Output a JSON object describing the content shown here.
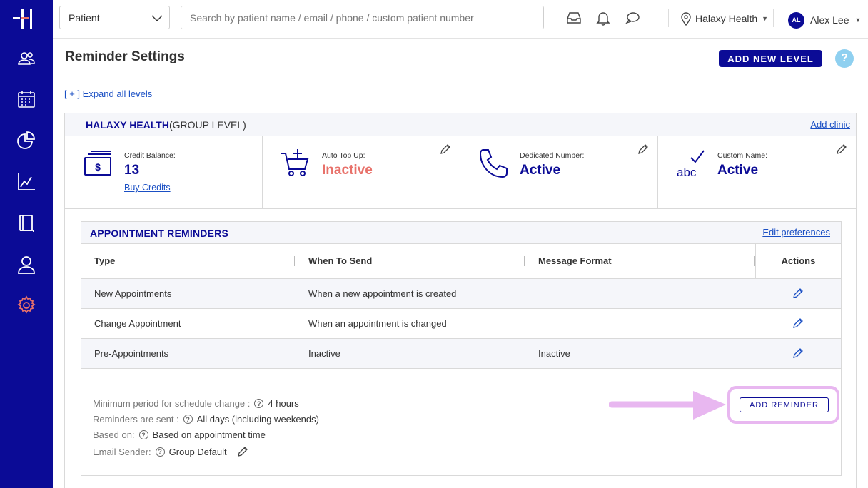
{
  "colors": {
    "brand": "#0b0b96",
    "link": "#1a4fc4",
    "inactive": "#e8716a",
    "highlight": "#e8b7f0",
    "settings_active": "#e8716a"
  },
  "sidebar": {
    "items": [
      {
        "icon": "users-icon"
      },
      {
        "icon": "calendar-icon"
      },
      {
        "icon": "pie-chart-icon"
      },
      {
        "icon": "line-chart-icon"
      },
      {
        "icon": "book-icon"
      },
      {
        "icon": "user-icon"
      },
      {
        "icon": "settings-icon"
      }
    ]
  },
  "topbar": {
    "filter_value": "Patient",
    "search_placeholder": "Search by patient name / email / phone / custom patient number",
    "location": "Halaxy Health",
    "user_initials": "AL",
    "user_name": "Alex Lee"
  },
  "page": {
    "title": "Reminder Settings",
    "add_level_label": "ADD NEW LEVEL",
    "help": "?",
    "expand_all": "[ + ] Expand all levels"
  },
  "group": {
    "collapse": "—",
    "name": "HALAXY HEALTH",
    "level": "(GROUP LEVEL)",
    "add_clinic": "Add clinic",
    "cards": [
      {
        "label": "Credit Balance:",
        "value": "13",
        "link": "Buy Credits"
      },
      {
        "label": "Auto Top Up:",
        "value": "Inactive"
      },
      {
        "label": "Dedicated Number:",
        "value": "Active"
      },
      {
        "label": "Custom Name:",
        "value": "Active"
      }
    ]
  },
  "reminders": {
    "title": "APPOINTMENT REMINDERS",
    "edit_preferences": "Edit preferences",
    "columns": [
      "Type",
      "When To Send",
      "Message Format",
      "Actions"
    ],
    "rows": [
      {
        "type": "New Appointments",
        "when": "When a new appointment is created",
        "format": ""
      },
      {
        "type": "Change Appointment",
        "when": "When an appointment is changed",
        "format": ""
      },
      {
        "type": "Pre-Appointments",
        "when": "Inactive",
        "format": "Inactive"
      }
    ],
    "info": {
      "min_period_label": "Minimum period for schedule change :",
      "min_period_value": "4 hours",
      "sent_label": "Reminders are sent :",
      "sent_value": "All days (including weekends)",
      "based_label": "Based on:",
      "based_value": "Based on appointment time",
      "sender_label": "Email Sender:",
      "sender_value": "Group Default"
    },
    "add_reminder_label": "ADD REMINDER"
  }
}
